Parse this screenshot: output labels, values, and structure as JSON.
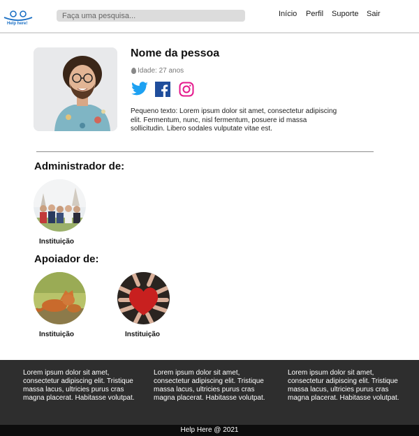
{
  "header": {
    "logo_text": "Help here!",
    "search_placeholder": "Faça uma pesquisa...",
    "nav": [
      "Início",
      "Perfil",
      "Suporte",
      "Sair"
    ]
  },
  "profile": {
    "name": "Nome da pessoa",
    "age": "Idade: 27 anos",
    "bio": "Pequeno texto: Lorem ipsum dolor sit amet, consectetur adipiscing elit. Fermentum, nunc, nisl fermentum, posuere id massa sollicitudin. Libero sodales vulputate vitae est.",
    "social_icons": [
      "twitter-icon",
      "facebook-icon",
      "instagram-icon"
    ]
  },
  "admin": {
    "title": "Administrador de:",
    "items": [
      {
        "label": "Instituição"
      }
    ]
  },
  "supporter": {
    "title": "Apoiador de:",
    "items": [
      {
        "label": "Instituição"
      },
      {
        "label": "Instituição"
      }
    ]
  },
  "footer": {
    "columns": [
      "Lorem ipsum dolor sit amet, consectetur adipiscing elit. Tristique massa lacus, ultricies purus cras magna placerat. Habitasse volutpat.",
      "Lorem ipsum dolor sit amet, consectetur adipiscing elit. Tristique massa lacus, ultricies purus cras magna placerat. Habitasse volutpat.",
      "Lorem ipsum dolor sit amet, consectetur adipiscing elit. Tristique massa lacus, ultricies purus cras magna placerat. Habitasse volutpat."
    ],
    "copyright": "Help Here @ 2021"
  },
  "colors": {
    "footer_bg": "#2e2e2e",
    "bottom_bar_bg": "#0d0d0d",
    "twitter": "#1da1f2",
    "facebook": "#1877f2",
    "instagram": "#e4188c",
    "logo": "#1a6fc4"
  }
}
